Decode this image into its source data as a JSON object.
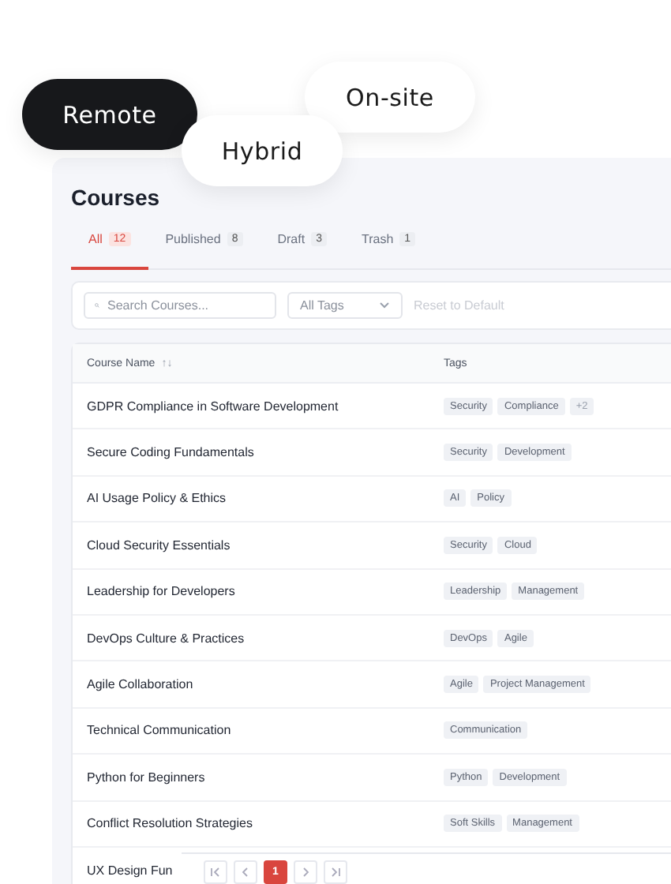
{
  "mode_pills": [
    {
      "label": "Remote",
      "selected": true
    },
    {
      "label": "Hybrid",
      "selected": false
    },
    {
      "label": "On-site",
      "selected": false
    }
  ],
  "title": "Courses",
  "tabs": [
    {
      "label": "All",
      "count": "12",
      "selected": true
    },
    {
      "label": "Published",
      "count": "8",
      "selected": false
    },
    {
      "label": "Draft",
      "count": "3",
      "selected": false
    },
    {
      "label": "Trash",
      "count": "1",
      "selected": false
    }
  ],
  "search": {
    "placeholder": "Search Courses..."
  },
  "tag_filter": {
    "value": "All Tags"
  },
  "reset_button": {
    "label": "Reset to Default",
    "disabled": true
  },
  "table": {
    "columns": [
      {
        "label": "Course Name",
        "sort_icon": "↑↓"
      },
      {
        "label": "Tags"
      }
    ],
    "rows": [
      {
        "name": "GDPR Compliance in Software Development",
        "tags": [
          "Security",
          "Compliance"
        ],
        "more": "+2"
      },
      {
        "name": "Secure Coding Fundamentals",
        "tags": [
          "Security",
          "Development"
        ]
      },
      {
        "name": "AI Usage Policy & Ethics",
        "tags": [
          "AI",
          "Policy"
        ]
      },
      {
        "name": "Cloud Security Essentials",
        "tags": [
          "Security",
          "Cloud"
        ]
      },
      {
        "name": "Leadership for Developers",
        "tags": [
          "Leadership",
          "Management"
        ]
      },
      {
        "name": "DevOps Culture & Practices",
        "tags": [
          "DevOps",
          "Agile"
        ]
      },
      {
        "name": "Agile Collaboration",
        "tags": [
          "Agile",
          "Project Management"
        ]
      },
      {
        "name": "Technical Communication",
        "tags": [
          "Communication"
        ]
      },
      {
        "name": "Python for Beginners",
        "tags": [
          "Python",
          "Development"
        ]
      },
      {
        "name": "Conflict Resolution Strategies",
        "tags": [
          "Soft Skills",
          "Management"
        ]
      },
      {
        "name": "UX Design Fun",
        "tags": []
      }
    ]
  },
  "pagination": [
    {
      "kind": "first",
      "selected": false
    },
    {
      "kind": "prev",
      "selected": false
    },
    {
      "kind": "page",
      "label": "1",
      "selected": true
    },
    {
      "kind": "next",
      "selected": false
    },
    {
      "kind": "last",
      "selected": false
    }
  ]
}
